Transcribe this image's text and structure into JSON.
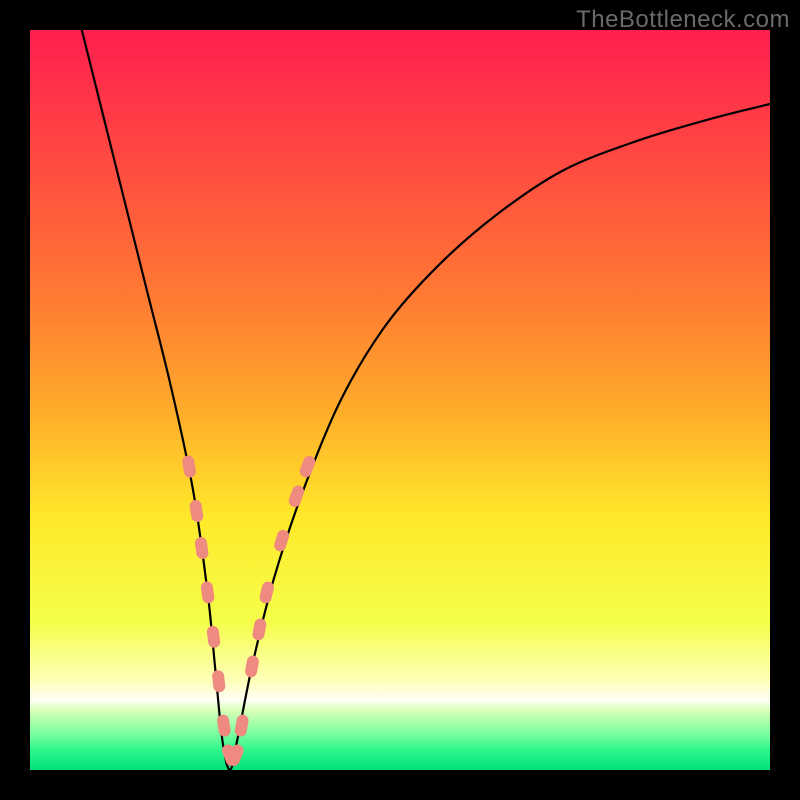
{
  "attribution": "TheBottleneck.com",
  "chart_data": {
    "type": "line",
    "title": "",
    "xlabel": "",
    "ylabel": "",
    "xlim": [
      0,
      100
    ],
    "ylim": [
      0,
      100
    ],
    "grid": false,
    "legend": "none",
    "annotations": [],
    "series": [
      {
        "name": "bottleneck-curve",
        "color": "#000000",
        "x": [
          7,
          10,
          13,
          16,
          19,
          22,
          24,
          25,
          26,
          27,
          28,
          30,
          33,
          37,
          42,
          48,
          55,
          63,
          72,
          82,
          92,
          100
        ],
        "y": [
          100,
          88,
          76,
          64,
          52,
          38,
          24,
          14,
          4,
          0,
          4,
          14,
          26,
          38,
          50,
          60,
          68,
          75,
          81,
          85,
          88,
          90
        ]
      }
    ],
    "markers": {
      "name": "highlighted-points",
      "shape": "rounded-capsule",
      "color": "#ee8a80",
      "points": [
        {
          "x": 21.5,
          "y": 41
        },
        {
          "x": 22.5,
          "y": 35
        },
        {
          "x": 23.2,
          "y": 30
        },
        {
          "x": 24.0,
          "y": 24
        },
        {
          "x": 24.8,
          "y": 18
        },
        {
          "x": 25.5,
          "y": 12
        },
        {
          "x": 26.2,
          "y": 6
        },
        {
          "x": 27.0,
          "y": 2
        },
        {
          "x": 27.8,
          "y": 2
        },
        {
          "x": 28.6,
          "y": 6
        },
        {
          "x": 30.0,
          "y": 14
        },
        {
          "x": 31.0,
          "y": 19
        },
        {
          "x": 32.0,
          "y": 24
        },
        {
          "x": 34.0,
          "y": 31
        },
        {
          "x": 36.0,
          "y": 37
        },
        {
          "x": 37.5,
          "y": 41
        }
      ]
    },
    "background_gradient": {
      "type": "vertical",
      "stops": [
        {
          "pos": 0.0,
          "color": "#ff1f4f"
        },
        {
          "pos": 0.18,
          "color": "#ff4a41"
        },
        {
          "pos": 0.36,
          "color": "#ff7a33"
        },
        {
          "pos": 0.52,
          "color": "#ffae2a"
        },
        {
          "pos": 0.66,
          "color": "#ffe92a"
        },
        {
          "pos": 0.8,
          "color": "#f4ff4a"
        },
        {
          "pos": 0.88,
          "color": "#ffffb9"
        },
        {
          "pos": 0.905,
          "color": "#fffef6"
        },
        {
          "pos": 0.92,
          "color": "#d6ffb8"
        },
        {
          "pos": 0.95,
          "color": "#7dffa0"
        },
        {
          "pos": 0.975,
          "color": "#29f58a"
        },
        {
          "pos": 1.0,
          "color": "#00e07a"
        }
      ]
    }
  }
}
